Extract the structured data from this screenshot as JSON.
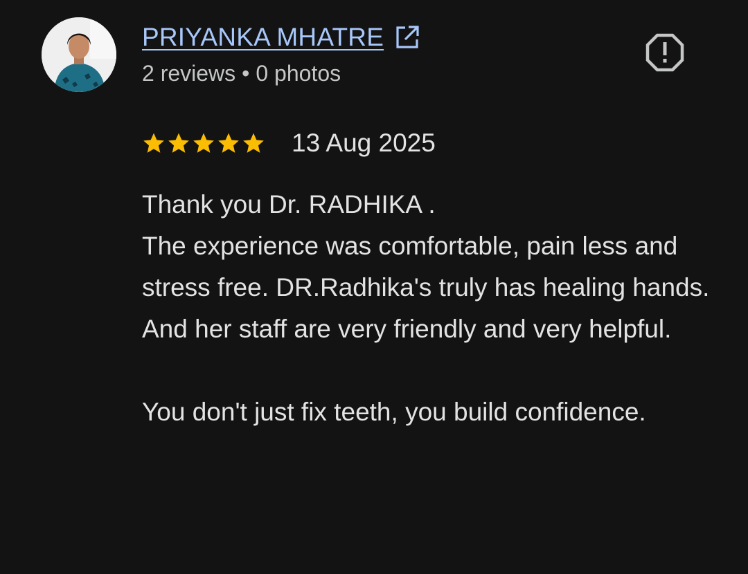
{
  "reviewer": {
    "name": "PRIYANKA MHATRE",
    "reviews_count": "2 reviews",
    "separator": "•",
    "photos_count": "0 photos"
  },
  "icons": {
    "external_link": "open-in-new-icon",
    "report": "report-flag-icon",
    "star": "star-icon"
  },
  "review": {
    "rating": 5,
    "date": "13 Aug 2025",
    "lines": [
      "Thank you Dr. RADHIKA .",
      "The experience was comfortable, pain less and stress free. DR.Radhika's truly has healing hands.",
      "And her staff are very friendly and very helpful.",
      "",
      "You don't just fix teeth, you build confidence."
    ]
  },
  "colors": {
    "background": "#131313",
    "link": "#a8c7fa",
    "star": "#fbbc04",
    "text": "#e3e3e3",
    "secondary_text": "#c4c7c5"
  }
}
